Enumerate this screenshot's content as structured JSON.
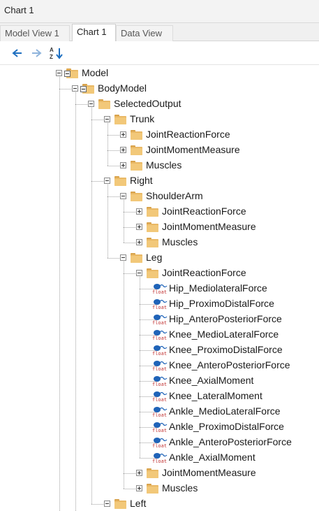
{
  "window": {
    "title": "Chart 1"
  },
  "tabs": [
    {
      "label": "Model View 1",
      "active": false
    },
    {
      "label": "Chart 1",
      "active": true
    },
    {
      "label": "Data View",
      "active": false
    }
  ],
  "toolbar": {
    "back_icon": "arrow-left-icon",
    "forward_icon": "arrow-right-icon",
    "sort_icon": "sort-az-icon"
  },
  "tree": [
    {
      "label": "Model",
      "type": "folder",
      "level": 0,
      "expanded": true
    },
    {
      "label": "BodyModel",
      "type": "folder",
      "level": 1,
      "expanded": true
    },
    {
      "label": "SelectedOutput",
      "type": "folder",
      "level": 2,
      "expanded": true
    },
    {
      "label": "Trunk",
      "type": "folder",
      "level": 3,
      "expanded": true
    },
    {
      "label": "JointReactionForce",
      "type": "folder",
      "level": 4,
      "expanded": false
    },
    {
      "label": "JointMomentMeasure",
      "type": "folder",
      "level": 4,
      "expanded": false
    },
    {
      "label": "Muscles",
      "type": "folder",
      "level": 4,
      "expanded": false
    },
    {
      "label": "Right",
      "type": "folder",
      "level": 3,
      "expanded": true
    },
    {
      "label": "ShoulderArm",
      "type": "folder",
      "level": 4,
      "expanded": true
    },
    {
      "label": "JointReactionForce",
      "type": "folder",
      "level": 5,
      "expanded": false
    },
    {
      "label": "JointMomentMeasure",
      "type": "folder",
      "level": 5,
      "expanded": false
    },
    {
      "label": "Muscles",
      "type": "folder",
      "level": 5,
      "expanded": false
    },
    {
      "label": "Leg",
      "type": "folder",
      "level": 4,
      "expanded": true
    },
    {
      "label": "JointReactionForce",
      "type": "folder",
      "level": 5,
      "expanded": true
    },
    {
      "label": "Hip_MediolateralForce",
      "type": "float",
      "level": 6
    },
    {
      "label": "Hip_ProximoDistalForce",
      "type": "float",
      "level": 6
    },
    {
      "label": "Hip_AnteroPosteriorForce",
      "type": "float",
      "level": 6
    },
    {
      "label": "Knee_MedioLateralForce",
      "type": "float",
      "level": 6
    },
    {
      "label": "Knee_ProximoDistalForce",
      "type": "float",
      "level": 6
    },
    {
      "label": "Knee_AnteroPosteriorForce",
      "type": "float",
      "level": 6
    },
    {
      "label": "Knee_AxialMoment",
      "type": "float",
      "level": 6
    },
    {
      "label": "Knee_LateralMoment",
      "type": "float",
      "level": 6
    },
    {
      "label": "Ankle_MedioLateralForce",
      "type": "float",
      "level": 6
    },
    {
      "label": "Ankle_ProximoDistalForce",
      "type": "float",
      "level": 6
    },
    {
      "label": "Ankle_AnteroPosteriorForce",
      "type": "float",
      "level": 6
    },
    {
      "label": "Ankle_AxialMoment",
      "type": "float",
      "level": 6
    },
    {
      "label": "JointMomentMeasure",
      "type": "folder",
      "level": 5,
      "expanded": false
    },
    {
      "label": "Muscles",
      "type": "folder",
      "level": 5,
      "expanded": false
    },
    {
      "label": "Left",
      "type": "folder",
      "level": 3,
      "expanded": true
    }
  ],
  "float_icon_text": "float",
  "colors": {
    "folder": "#f2c879",
    "accent_arrow": "#1e6fc0",
    "float_icon_blue": "#1f63b8",
    "float_icon_red": "#c03030"
  }
}
